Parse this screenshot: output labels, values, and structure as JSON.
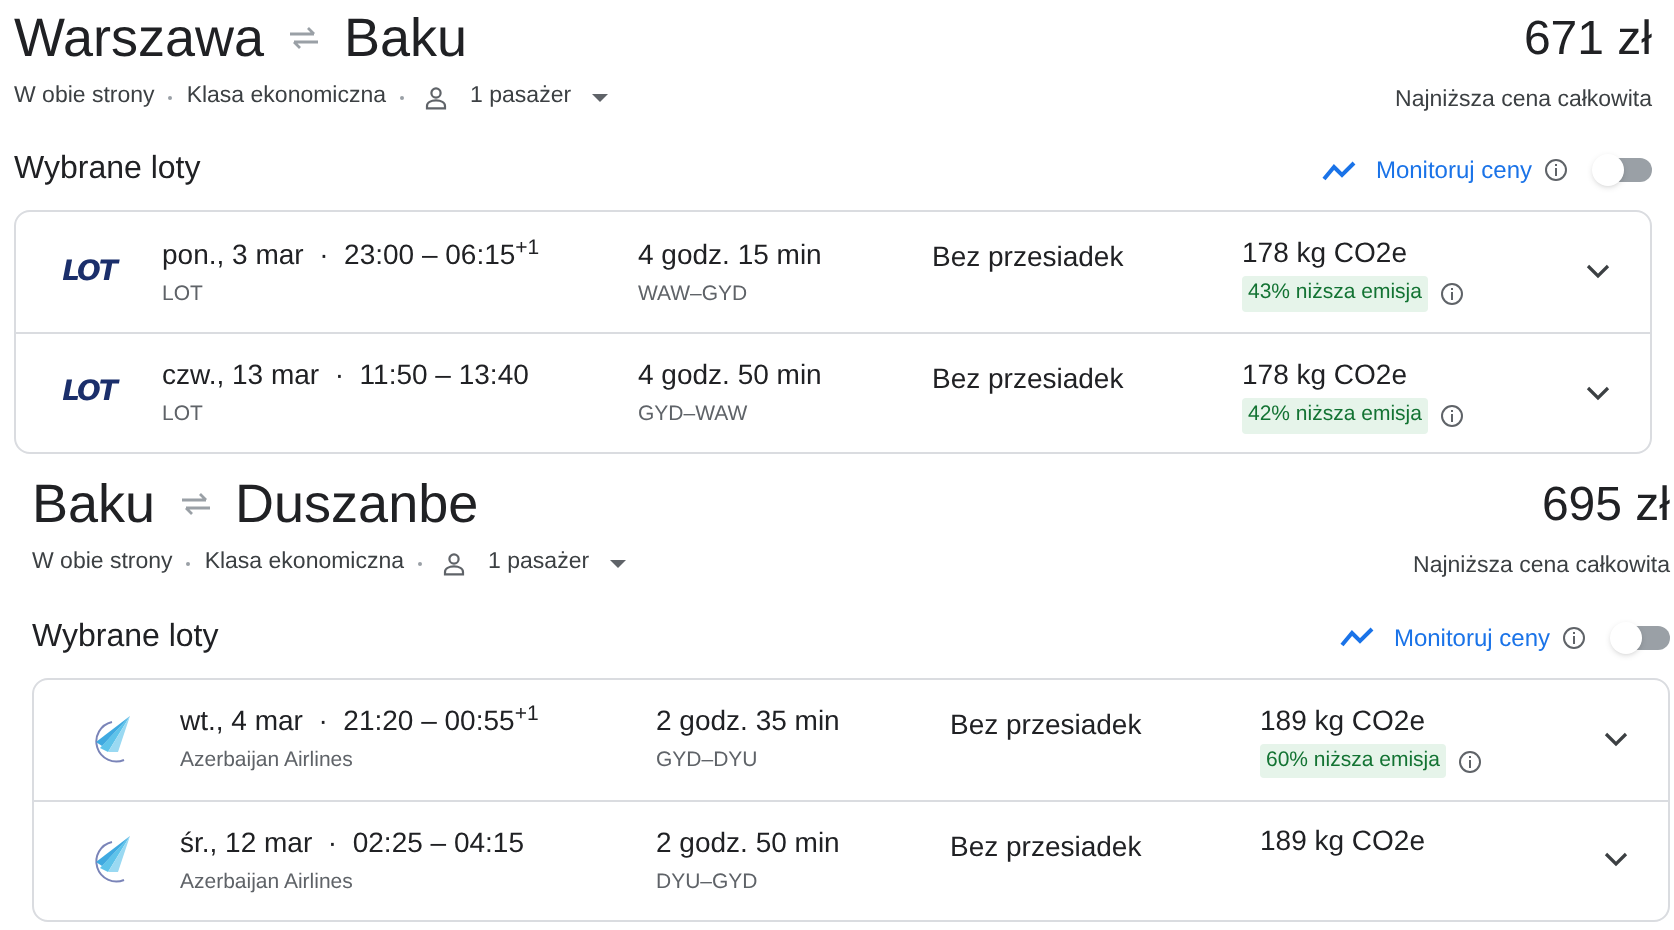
{
  "trips": [
    {
      "from": "Warszawa",
      "to": "Baku",
      "price": "671 zł",
      "price_note": "Najniższa cena całkowita",
      "trip_type": "W obie strony",
      "cabin": "Klasa ekonomiczna",
      "passengers": "1 pasażer",
      "heading": "Wybrane loty",
      "monitor": {
        "label": "Monitoruj ceny",
        "on": false
      },
      "flights": [
        {
          "logo": {
            "kind": "lot",
            "text": "LOT"
          },
          "times": "pon., 3 mar  ·  23:00 – 06:15$^{+1}$",
          "airline": "LOT",
          "duration": "4 godz. 15 min",
          "route": "WAW–GYD",
          "stops": "Bez przesiadek",
          "emissions": "178 kg CO2e",
          "emission_badge": "43% niższa emisja",
          "expanded": false
        },
        {
          "logo": {
            "kind": "lot",
            "text": "LOT"
          },
          "times": "czw., 13 mar  ·  11:50 – 13:40",
          "airline": "LOT",
          "duration": "4 godz. 50 min",
          "route": "GYD–WAW",
          "stops": "Bez przesiadek",
          "emissions": "178 kg CO2e",
          "emission_badge": "42% niższa emisja",
          "expanded": false
        }
      ]
    },
    {
      "from": "Baku",
      "to": "Duszanbe",
      "price": "695 zł",
      "price_note": "Najniższa cena całkowita",
      "trip_type": "W obie strony",
      "cabin": "Klasa ekonomiczna",
      "passengers": "1 pasażer",
      "heading": "Wybrane loty",
      "monitor": {
        "label": "Monitoruj ceny",
        "on": false
      },
      "flights": [
        {
          "logo": {
            "kind": "azal"
          },
          "times": "wt., 4 mar  ·  21:20 – 00:55$^{+1}$",
          "airline": "Azerbaijan Airlines",
          "duration": "2 godz. 35 min",
          "route": "GYD–DYU",
          "stops": "Bez przesiadek",
          "emissions": "189 kg CO2e",
          "emission_badge": "60% niższa emisja",
          "expanded": false
        },
        {
          "logo": {
            "kind": "azal"
          },
          "times": "śr., 12 mar  ·  02:25 – 04:15",
          "airline": "Azerbaijan Airlines",
          "duration": "2 godz. 50 min",
          "route": "DYU–GYD",
          "stops": "Bez przesiadek",
          "emissions": "189 kg CO2e",
          "expanded": false
        }
      ]
    }
  ]
}
